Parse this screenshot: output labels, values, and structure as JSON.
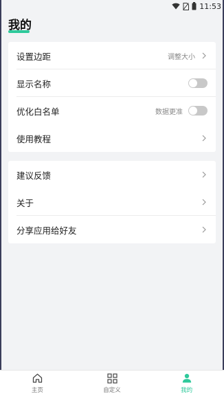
{
  "status_bar": {
    "time": "11:53",
    "icons": [
      "wifi-icon",
      "no-sim-icon",
      "battery-icon"
    ]
  },
  "page": {
    "title": "我的",
    "accent_color": "#2ec99b"
  },
  "settings_group_1": [
    {
      "label": "设置边距",
      "value": "调整大小",
      "control": "chevron-right-icon"
    },
    {
      "label": "显示名称",
      "control": "toggle",
      "toggle_on": false
    },
    {
      "label": "优化白名单",
      "value": "数据更准",
      "control": "toggle",
      "toggle_on": false
    },
    {
      "label": "使用教程",
      "control": "chevron-right-icon"
    }
  ],
  "settings_group_2": [
    {
      "label": "建议反馈",
      "control": "chevron-right-icon"
    },
    {
      "label": "关于",
      "control": "chevron-right-icon"
    },
    {
      "label": "分享应用给好友",
      "control": "chevron-right-icon"
    }
  ],
  "tab_bar": {
    "tabs": [
      {
        "label": "主页",
        "icon": "home-icon",
        "active": false
      },
      {
        "label": "自定义",
        "icon": "grid-icon",
        "active": false
      },
      {
        "label": "我的",
        "icon": "person-icon",
        "active": true
      }
    ]
  }
}
